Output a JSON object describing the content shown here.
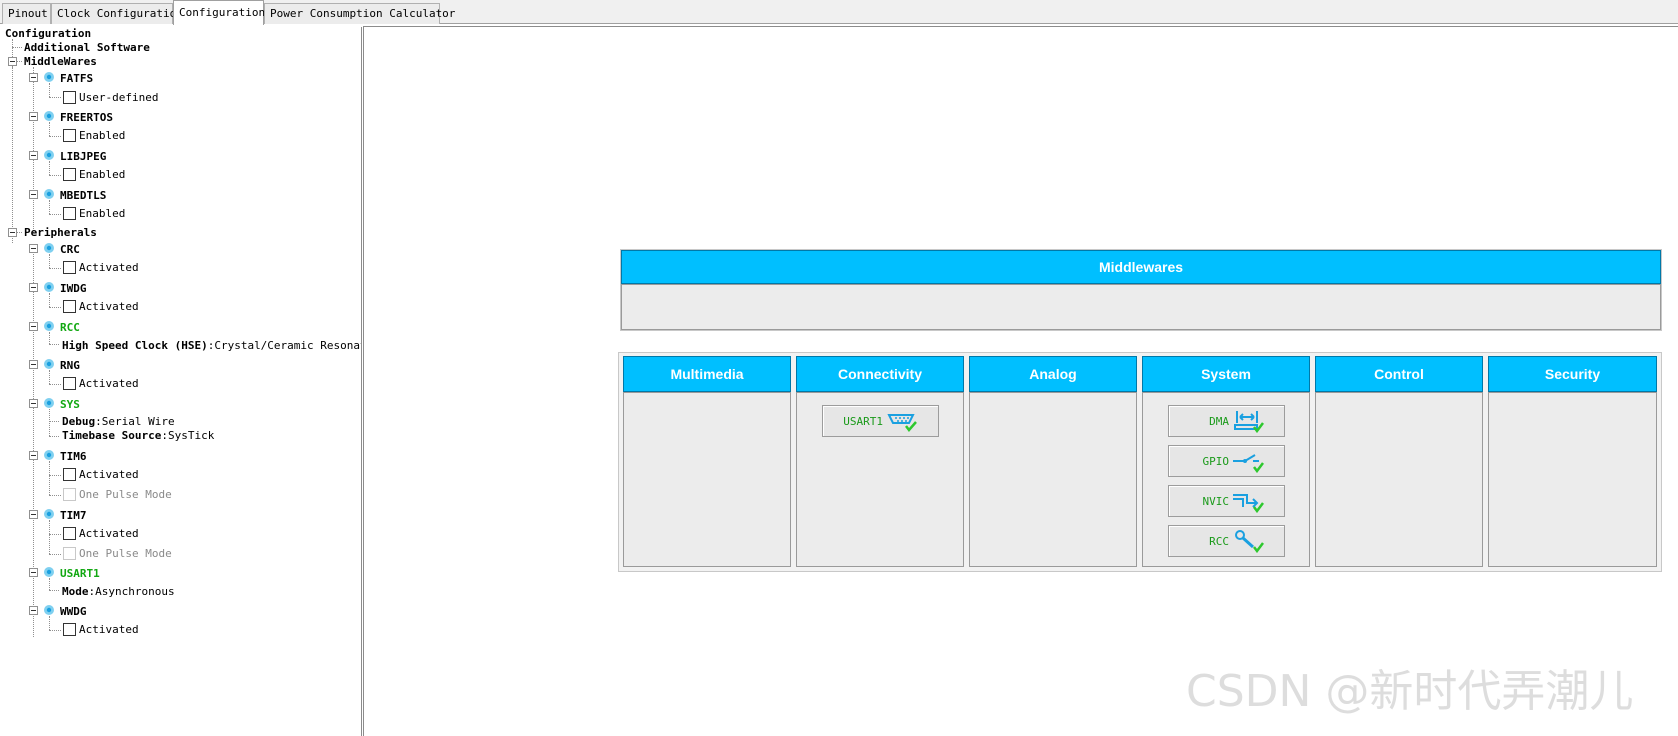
{
  "tabs": [
    {
      "label": "Pinout",
      "active": false
    },
    {
      "label": "Clock Configuration",
      "active": false
    },
    {
      "label": "Configuration",
      "active": true
    },
    {
      "label": "Power Consumption Calculator",
      "active": false
    }
  ],
  "tree": {
    "root": "Configuration",
    "additional_software": "Additional Software",
    "middlewares": {
      "label": "MiddleWares",
      "items": [
        {
          "name": "FATFS",
          "checkbox": "User-defined"
        },
        {
          "name": "FREERTOS",
          "checkbox": "Enabled"
        },
        {
          "name": "LIBJPEG",
          "checkbox": "Enabled"
        },
        {
          "name": "MBEDTLS",
          "checkbox": "Enabled"
        }
      ]
    },
    "peripherals": {
      "label": "Peripherals",
      "crc": {
        "name": "CRC",
        "checkbox": "Activated"
      },
      "iwdg": {
        "name": "IWDG",
        "checkbox": "Activated"
      },
      "rcc": {
        "name": "RCC",
        "key": "High Speed Clock (HSE)",
        "value": "Crystal/Ceramic Resonat"
      },
      "rng": {
        "name": "RNG",
        "checkbox": "Activated"
      },
      "sys": {
        "name": "SYS",
        "key1": "Debug",
        "value1": "Serial Wire",
        "key2": "Timebase Source",
        "value2": "SysTick"
      },
      "tim6": {
        "name": "TIM6",
        "checkbox1": "Activated",
        "checkbox2": "One Pulse Mode"
      },
      "tim7": {
        "name": "TIM7",
        "checkbox1": "Activated",
        "checkbox2": "One Pulse Mode"
      },
      "usart1": {
        "name": "USART1",
        "key": "Mode",
        "value": "Asynchronous"
      },
      "wwdg": {
        "name": "WWDG",
        "checkbox": "Activated"
      }
    }
  },
  "main": {
    "middlewares_title": "Middlewares",
    "categories": [
      "Multimedia",
      "Connectivity",
      "Analog",
      "System",
      "Control",
      "Security"
    ],
    "connectivity_items": [
      "USART1"
    ],
    "system_items": [
      "DMA",
      "GPIO",
      "NVIC",
      "RCC"
    ]
  },
  "colors": {
    "header_blue": "#00bfff",
    "status_green": "#12a812",
    "icon_blue": "#1aa0e0",
    "check_green": "#2ec82e"
  },
  "watermark": "CSDN @新时代弄潮儿"
}
